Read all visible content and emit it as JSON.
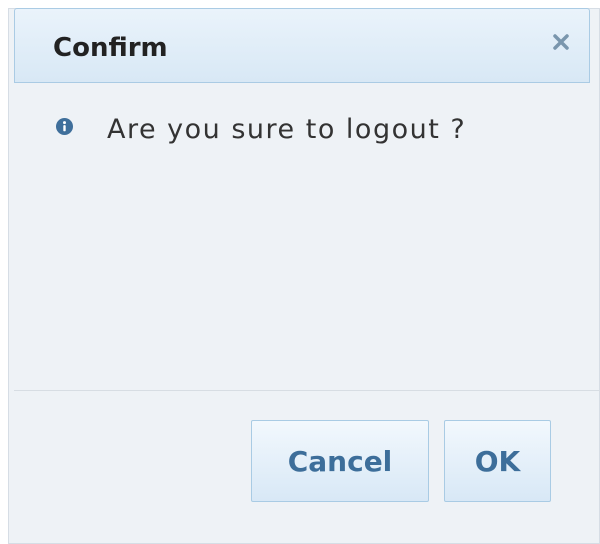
{
  "dialog": {
    "title": "Confirm",
    "close_icon": "close-icon",
    "message_icon": "info-icon",
    "message": "Are you sure to logout ?",
    "buttons": {
      "cancel_label": "Cancel",
      "ok_label": "OK"
    },
    "colors": {
      "accent": "#3d6e9a",
      "titlebar": "#d8e8f5",
      "background": "#eef2f6"
    }
  }
}
